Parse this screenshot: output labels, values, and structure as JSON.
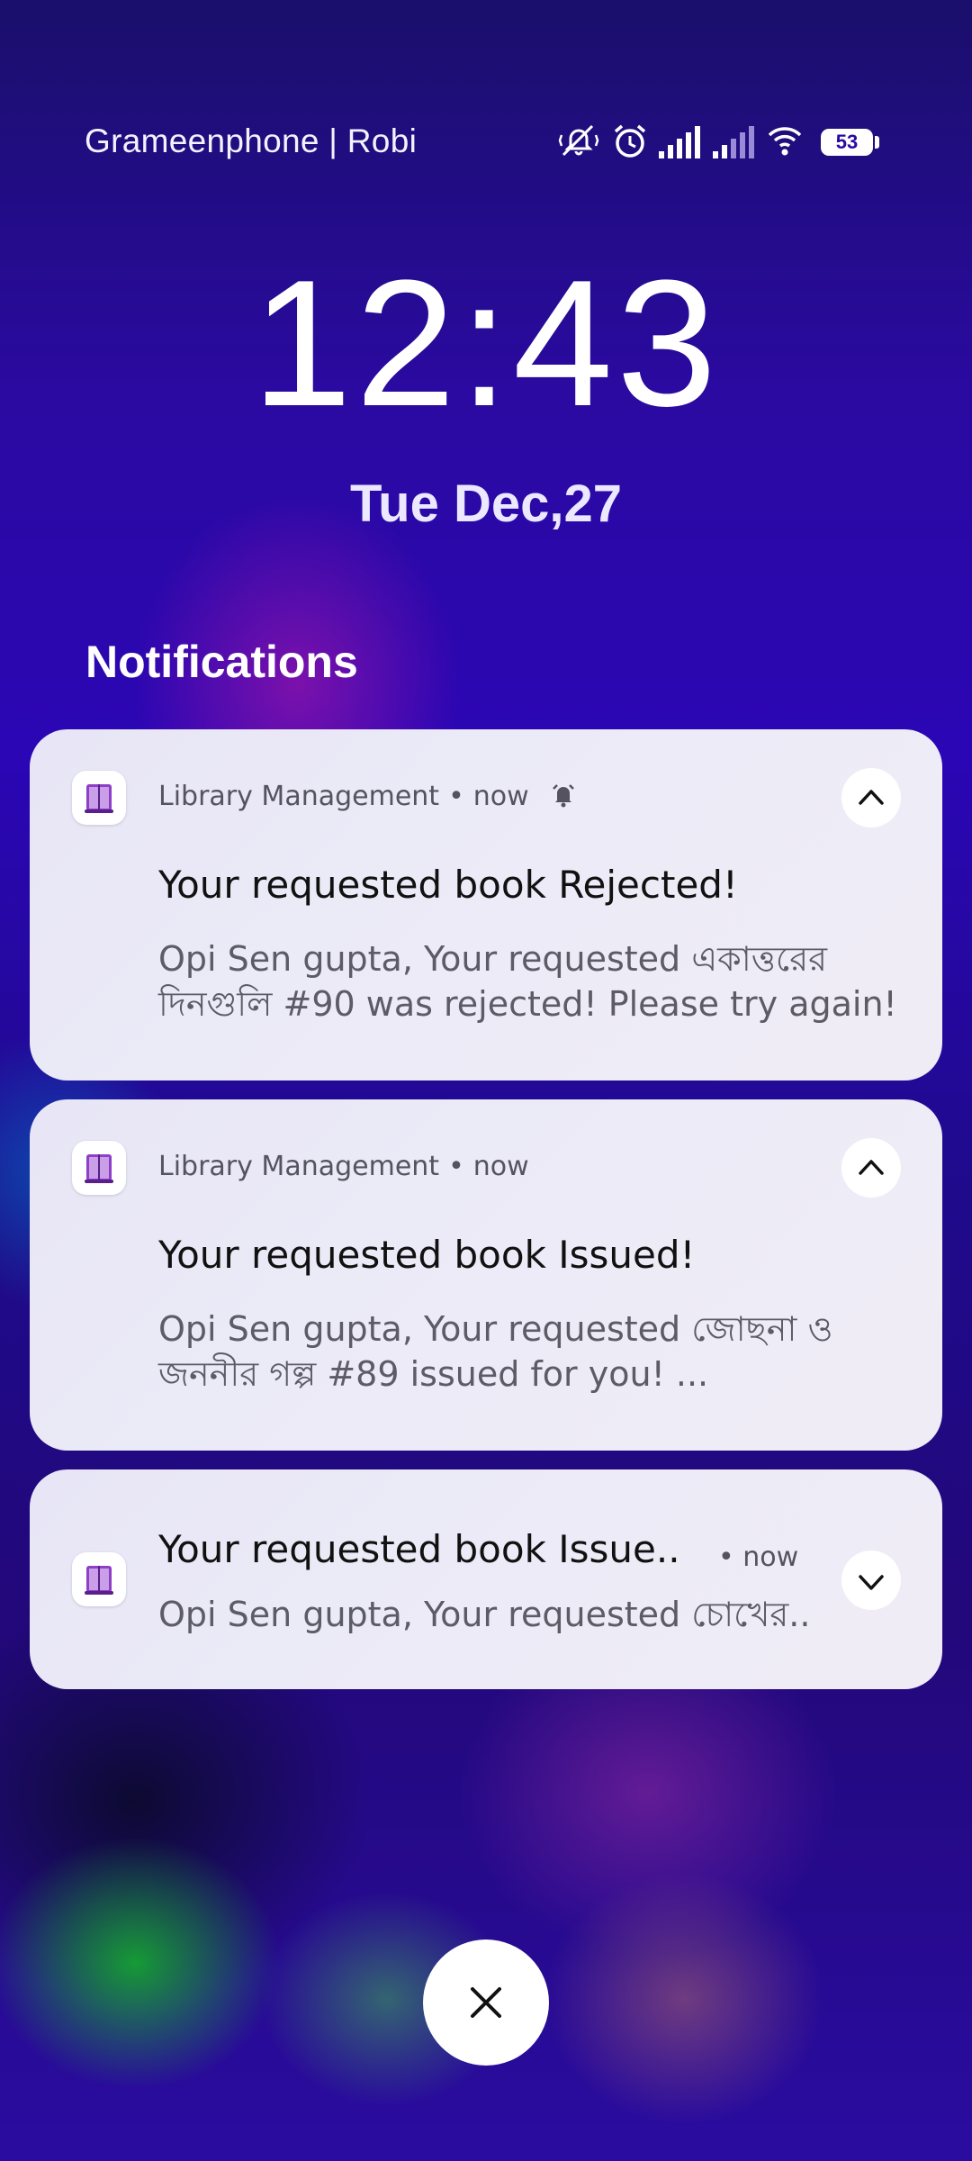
{
  "status_bar": {
    "carrier": "Grameenphone | Robi",
    "battery": "53",
    "icons": [
      "mute-vibrate-icon",
      "alarm-icon",
      "signal-sim1-icon",
      "signal-sim2-icon",
      "wifi-icon",
      "battery-icon"
    ]
  },
  "lockscreen": {
    "time": "12:43",
    "date": "Tue Dec,27",
    "section_title": "Notifications"
  },
  "notifications": [
    {
      "app": "Library Management",
      "time": "now",
      "title": "Your requested book Rejected!",
      "body": "Opi Sen gupta, Your requested একাত্তরের দিনগুলি #90 was rejected! Please try again!",
      "expanded": true,
      "bell_icon": "bell-icon"
    },
    {
      "app": "Library Management",
      "time": "now",
      "title": "Your requested book Issued!",
      "body": "Opi Sen gupta, Your requested জোছনা ও জননীর গল্প #89 issued for you! ...",
      "expanded": true
    },
    {
      "title": "Your requested book Issue..",
      "time": "now",
      "body": "Opi Sen gupta, Your requested চোখের..",
      "expanded": false
    }
  ],
  "colors": {
    "background_primary": "#2b06b5",
    "card_background": "#ecebf7",
    "accent_purple": "#8e3ec7"
  }
}
